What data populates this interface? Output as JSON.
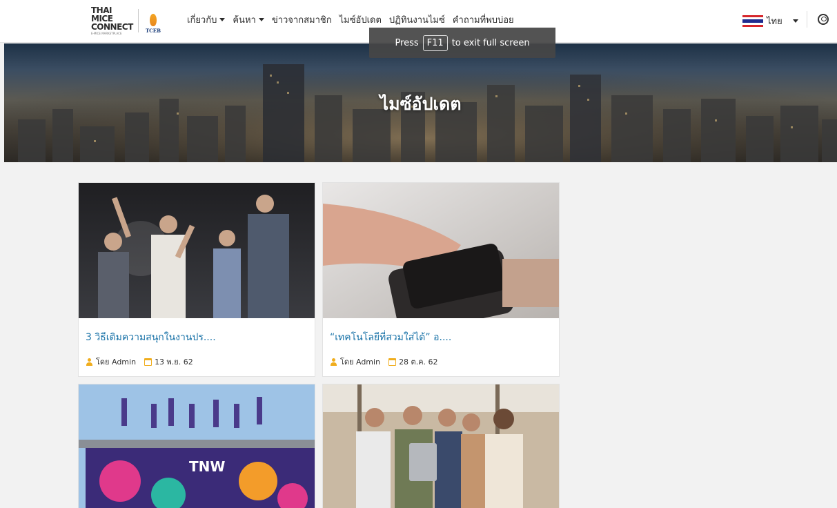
{
  "header": {
    "logo": {
      "line1": "THAI MICE",
      "line2": "CONNECT",
      "line3": "E-MICE MARKETPLACE",
      "org": "TCEB"
    },
    "nav": [
      {
        "label": "เกี่ยวกับ",
        "dropdown": true
      },
      {
        "label": "ค้นหา",
        "dropdown": true
      },
      {
        "label": "ข่าวจากสมาชิก",
        "dropdown": false
      },
      {
        "label": "ไมซ์อัปเดต",
        "dropdown": false
      },
      {
        "label": "ปฏิทินงานไมซ์",
        "dropdown": false
      },
      {
        "label": "คำถามที่พบบ่อย",
        "dropdown": false
      }
    ],
    "language": "ไทย",
    "account_icon": "user-circle-icon"
  },
  "fullscreen_notice": {
    "before": "Press",
    "key": "F11",
    "after": "to exit full screen"
  },
  "hero": {
    "title": "ไมซ์อัปเดต"
  },
  "posts": [
    {
      "title": "3 วิธีเติมความสนุกในงานปร....",
      "author": "โดย Admin",
      "date": "13 พ.ย. 62",
      "image": "concert-crowd"
    },
    {
      "title": "“เทคโนโลยีที่สวมใส่ได้” อ....",
      "author": "โดย Admin",
      "date": "28 ต.ค. 62",
      "image": "smartwatch"
    },
    {
      "title": "",
      "author": "",
      "date": "",
      "image": "tnw-festival-stage"
    },
    {
      "title": "",
      "author": "",
      "date": "",
      "image": "team-office"
    }
  ],
  "colors": {
    "link": "#1a73a8",
    "icon_accent": "#f0ad1d",
    "page_bg": "#f2f2f2"
  }
}
